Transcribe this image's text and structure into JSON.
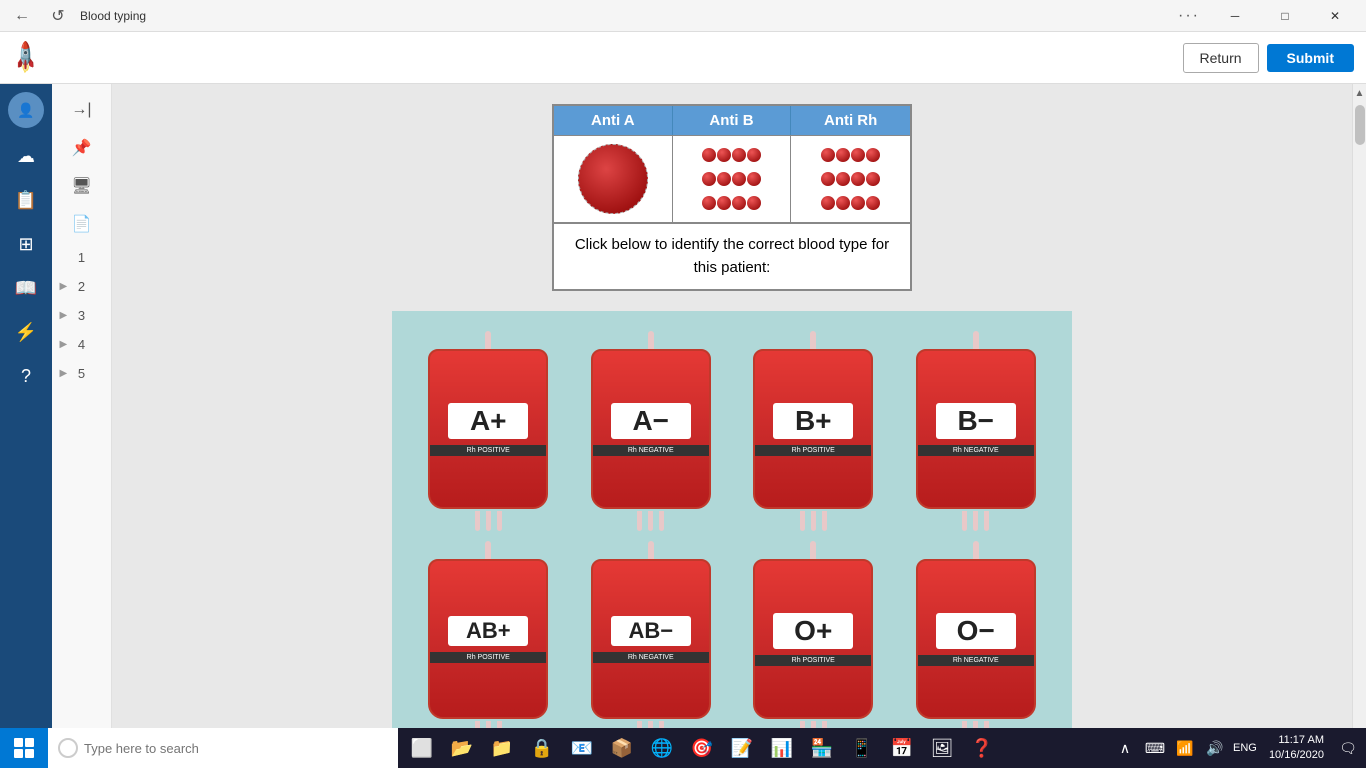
{
  "titlebar": {
    "title": "Blood typing",
    "more_btn": "···",
    "minimize": "─",
    "maximize": "□",
    "close": "✕"
  },
  "appbar": {
    "return_label": "Return",
    "submit_label": "Submit"
  },
  "sidebar_dark": {
    "icons": [
      "☁",
      "📋",
      "📊",
      "⚙",
      "?"
    ]
  },
  "sidebar_light": {
    "nav_items": [
      "1",
      "2",
      "3",
      "4",
      "5"
    ]
  },
  "antigen_headers": [
    "Anti A",
    "Anti B",
    "Anti Rh"
  ],
  "instruction": "Click below to identify the correct blood type for this patient:",
  "blood_bags": [
    {
      "type": "A+",
      "sub": "Rh POSITIVE"
    },
    {
      "type": "A−",
      "sub": "Rh NEGATIVE"
    },
    {
      "type": "B+",
      "sub": "Rh POSITIVE"
    },
    {
      "type": "B−",
      "sub": "Rh NEGATIVE"
    },
    {
      "type": "AB+",
      "sub": "Rh POSITIVE"
    },
    {
      "type": "AB−",
      "sub": "Rh NEGATIVE"
    },
    {
      "type": "O+",
      "sub": "Rh POSITIVE"
    },
    {
      "type": "O−",
      "sub": "Rh NEGATIVE"
    }
  ],
  "taskbar": {
    "search_placeholder": "Type here to search",
    "time": "11:17 AM",
    "date": "10/16/2020"
  }
}
